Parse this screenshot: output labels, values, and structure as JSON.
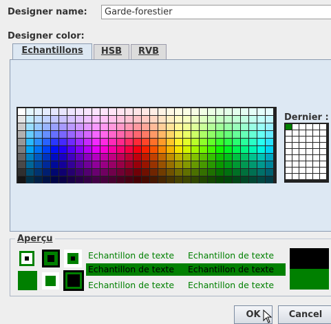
{
  "designer_name": {
    "label": "Designer name:",
    "value": "Garde-forestier"
  },
  "designer_color": {
    "label": "Designer color:"
  },
  "tabs": [
    {
      "label": "Echantillons",
      "selected": true
    },
    {
      "label": "HSB",
      "selected": false
    },
    {
      "label": "RVB",
      "selected": false
    }
  ],
  "swatches": {
    "recent_label": "Dernier :",
    "recent_first_color": "#008000"
  },
  "preview": {
    "label": "Aperçu",
    "sample_text": "Echantillon de texte",
    "color": "#008000",
    "dark": "#000000"
  },
  "buttons": {
    "ok": "OK",
    "cancel": "Cancel"
  }
}
